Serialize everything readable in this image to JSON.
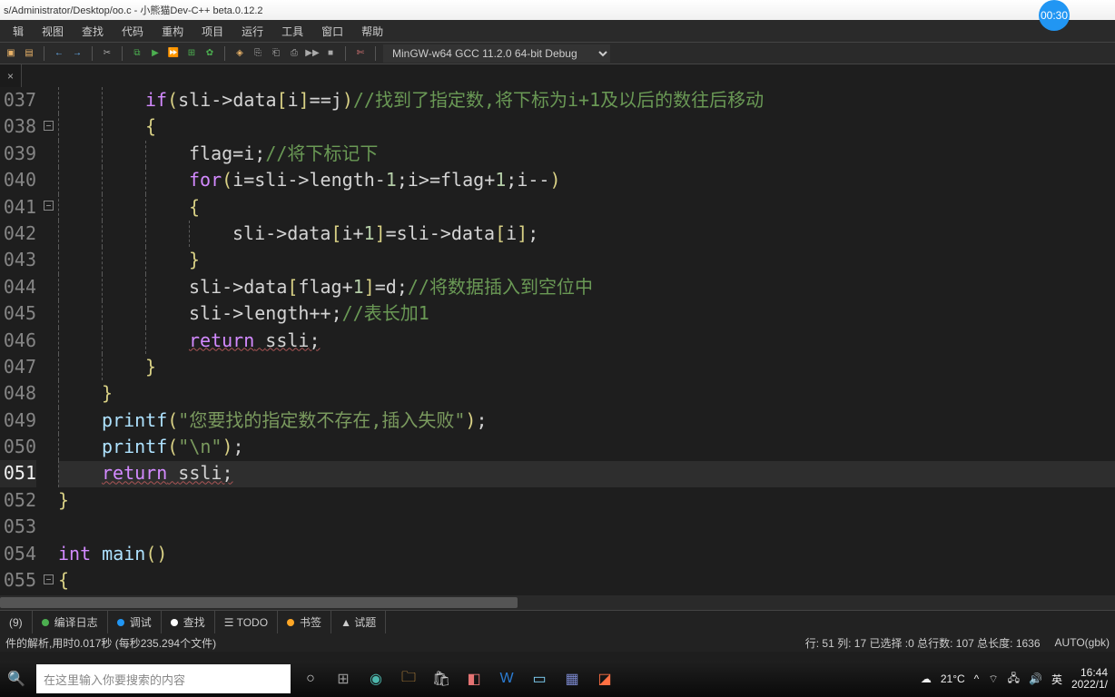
{
  "titlebar": {
    "path": "s/Administrator/Desktop/oo.c - 小熊猫Dev-C++  beta.0.12.2"
  },
  "badge": "00:30",
  "menu": {
    "items": [
      "辑",
      "视图",
      "查找",
      "代码",
      "重构",
      "项目",
      "运行",
      "工具",
      "窗口",
      "帮助"
    ]
  },
  "toolbar": {
    "compile_profile": "MinGW-w64 GCC 11.2.0 64-bit Debug"
  },
  "tab": {
    "label": "",
    "close": "×"
  },
  "gutter_lines": [
    "037",
    "038",
    "039",
    "040",
    "041",
    "042",
    "043",
    "044",
    "045",
    "046",
    "047",
    "048",
    "049",
    "050",
    "051",
    "052",
    "053",
    "054",
    "055"
  ],
  "current_line_index": 14,
  "code_lines": [
    {
      "indent": 8,
      "tokens": [
        {
          "t": "if",
          "c": "kw"
        },
        {
          "t": "(",
          "c": "br"
        },
        {
          "t": "sli",
          "c": "id"
        },
        {
          "t": "->",
          "c": "op"
        },
        {
          "t": "data",
          "c": "id"
        },
        {
          "t": "[",
          "c": "br"
        },
        {
          "t": "i",
          "c": "id"
        },
        {
          "t": "]",
          "c": "br"
        },
        {
          "t": "==",
          "c": "op"
        },
        {
          "t": "j",
          "c": "id"
        },
        {
          "t": ")",
          "c": "br"
        },
        {
          "t": "//找到了指定数,将下标为i+1及以后的数往后移动",
          "c": "cm"
        }
      ]
    },
    {
      "indent": 8,
      "tokens": [
        {
          "t": "{",
          "c": "br"
        }
      ]
    },
    {
      "indent": 12,
      "tokens": [
        {
          "t": "flag",
          "c": "id"
        },
        {
          "t": "=",
          "c": "op"
        },
        {
          "t": "i",
          "c": "id"
        },
        {
          "t": ";",
          "c": "op"
        },
        {
          "t": "//将下标记下",
          "c": "cm"
        }
      ]
    },
    {
      "indent": 12,
      "tokens": [
        {
          "t": "for",
          "c": "kw"
        },
        {
          "t": "(",
          "c": "br"
        },
        {
          "t": "i",
          "c": "id"
        },
        {
          "t": "=",
          "c": "op"
        },
        {
          "t": "sli",
          "c": "id"
        },
        {
          "t": "->",
          "c": "op"
        },
        {
          "t": "length",
          "c": "id"
        },
        {
          "t": "-",
          "c": "op"
        },
        {
          "t": "1",
          "c": "num"
        },
        {
          "t": ";",
          "c": "op"
        },
        {
          "t": "i",
          "c": "id"
        },
        {
          "t": ">=",
          "c": "op"
        },
        {
          "t": "flag",
          "c": "id"
        },
        {
          "t": "+",
          "c": "op"
        },
        {
          "t": "1",
          "c": "num"
        },
        {
          "t": ";",
          "c": "op"
        },
        {
          "t": "i",
          "c": "id"
        },
        {
          "t": "--",
          "c": "op"
        },
        {
          "t": ")",
          "c": "br"
        }
      ]
    },
    {
      "indent": 12,
      "tokens": [
        {
          "t": "{",
          "c": "br"
        }
      ]
    },
    {
      "indent": 16,
      "tokens": [
        {
          "t": "sli",
          "c": "id"
        },
        {
          "t": "->",
          "c": "op"
        },
        {
          "t": "data",
          "c": "id"
        },
        {
          "t": "[",
          "c": "br"
        },
        {
          "t": "i",
          "c": "id"
        },
        {
          "t": "+",
          "c": "op"
        },
        {
          "t": "1",
          "c": "num"
        },
        {
          "t": "]",
          "c": "br"
        },
        {
          "t": "=",
          "c": "op"
        },
        {
          "t": "sli",
          "c": "id"
        },
        {
          "t": "->",
          "c": "op"
        },
        {
          "t": "data",
          "c": "id"
        },
        {
          "t": "[",
          "c": "br"
        },
        {
          "t": "i",
          "c": "id"
        },
        {
          "t": "]",
          "c": "br"
        },
        {
          "t": ";",
          "c": "op"
        }
      ]
    },
    {
      "indent": 12,
      "tokens": [
        {
          "t": "}",
          "c": "br"
        }
      ]
    },
    {
      "indent": 12,
      "tokens": [
        {
          "t": "sli",
          "c": "id"
        },
        {
          "t": "->",
          "c": "op"
        },
        {
          "t": "data",
          "c": "id"
        },
        {
          "t": "[",
          "c": "br"
        },
        {
          "t": "flag",
          "c": "id"
        },
        {
          "t": "+",
          "c": "op"
        },
        {
          "t": "1",
          "c": "num"
        },
        {
          "t": "]",
          "c": "br"
        },
        {
          "t": "=",
          "c": "op"
        },
        {
          "t": "d",
          "c": "id"
        },
        {
          "t": ";",
          "c": "op"
        },
        {
          "t": "//将数据插入到空位中",
          "c": "cm"
        }
      ]
    },
    {
      "indent": 12,
      "tokens": [
        {
          "t": "sli",
          "c": "id"
        },
        {
          "t": "->",
          "c": "op"
        },
        {
          "t": "length",
          "c": "id"
        },
        {
          "t": "++",
          "c": "op"
        },
        {
          "t": ";",
          "c": "op"
        },
        {
          "t": "//表长加1",
          "c": "cm"
        }
      ]
    },
    {
      "indent": 12,
      "err": true,
      "tokens": [
        {
          "t": "return",
          "c": "kw"
        },
        {
          "t": " ",
          "c": "op"
        },
        {
          "t": "ssli",
          "c": "id"
        },
        {
          "t": ";",
          "c": "op"
        }
      ]
    },
    {
      "indent": 8,
      "tokens": [
        {
          "t": "}",
          "c": "br"
        }
      ]
    },
    {
      "indent": 4,
      "tokens": [
        {
          "t": "}",
          "c": "br"
        }
      ]
    },
    {
      "indent": 4,
      "tokens": [
        {
          "t": "printf",
          "c": "fn"
        },
        {
          "t": "(",
          "c": "br"
        },
        {
          "t": "\"您要找的指定数不存在,插入失败\"",
          "c": "str"
        },
        {
          "t": ")",
          "c": "br"
        },
        {
          "t": ";",
          "c": "op"
        }
      ]
    },
    {
      "indent": 4,
      "tokens": [
        {
          "t": "printf",
          "c": "fn"
        },
        {
          "t": "(",
          "c": "br"
        },
        {
          "t": "\"\\n\"",
          "c": "str"
        },
        {
          "t": ")",
          "c": "br"
        },
        {
          "t": ";",
          "c": "op"
        }
      ]
    },
    {
      "indent": 4,
      "err": true,
      "tokens": [
        {
          "t": "return",
          "c": "kw"
        },
        {
          "t": " ",
          "c": "op"
        },
        {
          "t": "ssli",
          "c": "id"
        },
        {
          "t": ";",
          "c": "op"
        }
      ]
    },
    {
      "indent": 0,
      "tokens": [
        {
          "t": "}",
          "c": "br"
        }
      ]
    },
    {
      "indent": 0,
      "tokens": []
    },
    {
      "indent": 0,
      "tokens": [
        {
          "t": "int",
          "c": "kw"
        },
        {
          "t": " ",
          "c": "op"
        },
        {
          "t": "main",
          "c": "fn"
        },
        {
          "t": "()",
          "c": "br"
        }
      ]
    },
    {
      "indent": 0,
      "tokens": [
        {
          "t": "{",
          "c": "br"
        }
      ]
    }
  ],
  "bottom_tabs": {
    "count": "(9)",
    "items": [
      {
        "dot": "#4caf50",
        "label": "编译日志"
      },
      {
        "dot": "#2196f3",
        "label": "调试"
      },
      {
        "dot": "#ffffff",
        "label": "查找"
      },
      {
        "dot": "",
        "label": "☰ TODO"
      },
      {
        "dot": "#ffa726",
        "label": "书签"
      },
      {
        "dot": "",
        "label": "▲ 试题"
      }
    ]
  },
  "status": {
    "left": "件的解析,用时0.017秒 (每秒235.294个文件)",
    "pos": "行: 51 列: 17 已选择 :0 总行数: 107 总长度: 1636",
    "encoding": "AUTO(gbk)"
  },
  "taskbar": {
    "search_placeholder": "在这里输入你要搜索的内容",
    "weather": "21°C",
    "ime": "英",
    "time": "16:44",
    "date": "2022/1/"
  }
}
